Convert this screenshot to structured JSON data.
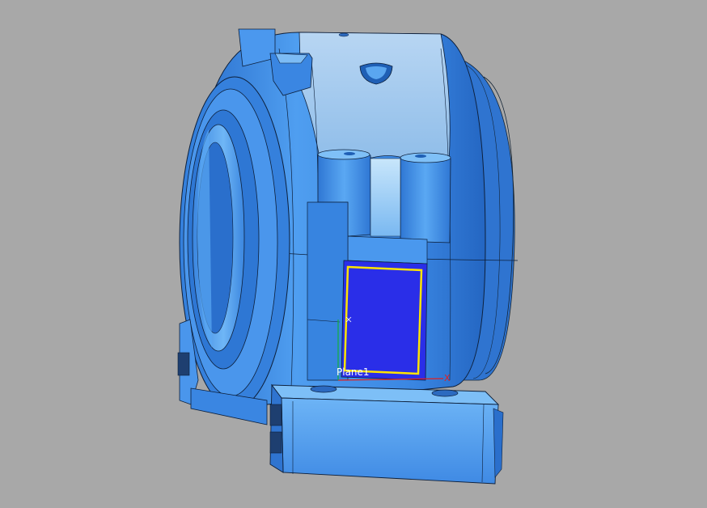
{
  "viewport": {
    "background": "#a8a8a8",
    "part_color": "#3d8be8",
    "part_light": "#63adf5",
    "part_dark": "#1f62b8",
    "cap_color": "#a9cdef",
    "selection_fill": "#2a2ee8",
    "sketch_color": "#ffe400"
  },
  "sketch": {
    "plane_label": "Plane1",
    "axis_x_label": "X"
  }
}
